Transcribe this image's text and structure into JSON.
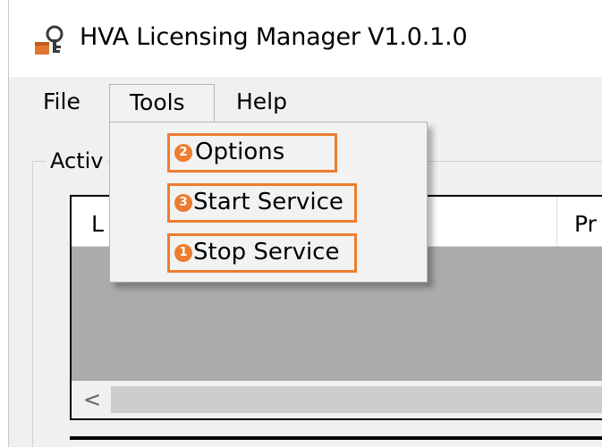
{
  "window": {
    "title": "HVA Licensing Manager V1.0.1.0",
    "icon": "key-lock-icon"
  },
  "menubar": {
    "items": [
      {
        "label": "File"
      },
      {
        "label": "Tools"
      },
      {
        "label": "Help"
      }
    ]
  },
  "tools_menu": {
    "items": [
      {
        "label": "Options",
        "step": "2"
      },
      {
        "label": "Start Service",
        "step": "3"
      },
      {
        "label": "Stop Service",
        "step": "1"
      }
    ]
  },
  "group": {
    "label": "Activ"
  },
  "list": {
    "columns": [
      {
        "label": "L"
      },
      {
        "label": "Pr"
      }
    ],
    "scroll_left_icon": "chevron-left-icon"
  },
  "colors": {
    "highlight": "#ed7d31",
    "list_body": "#ababab"
  }
}
